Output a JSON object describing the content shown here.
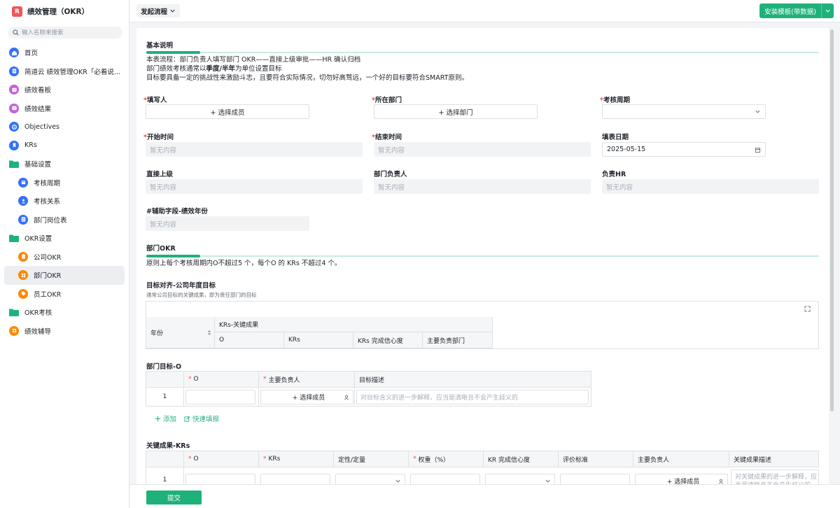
{
  "app": {
    "title": "绩效管理（OKR）",
    "logo": "R"
  },
  "search": {
    "placeholder": "输入名称来搜索"
  },
  "nav": {
    "home": "首页",
    "guide": "简道云 绩效管理OKR「必看说...",
    "board": "绩效看板",
    "result": "绩效结果",
    "objectives": "Objectives",
    "krs": "KRs",
    "basic_settings": "基础设置",
    "period": "考核周期",
    "relation": "考核关系",
    "positions": "部门岗位表",
    "okr_settings": "OKR设置",
    "company_okr": "公司OKR",
    "dept_okr": "部门OKR",
    "staff_okr": "员工OKR",
    "okr_review": "OKR考核",
    "coaching": "绩效辅导"
  },
  "toolbar": {
    "flow": "发起流程",
    "install": "安装模板(带数据)"
  },
  "basic": {
    "title": "基本说明",
    "line1": "本表流程：部门负责人填写部门 OKR——直接上级审批——HR 确认归档",
    "line2_a": "部门绩效考核通常以",
    "line2_b": "季度/半年",
    "line2_c": "为单位设置目标",
    "line3": "目标要具备一定的挑战性来激励斗志，且要符合实际情况，切勿好高骛远，一个好的目标要符合SMART原则。"
  },
  "fields": {
    "filler": "填写人",
    "filler_btn": "+ 选择成员",
    "dept": "所在部门",
    "dept_btn": "+ 选择部门",
    "cycle": "考核周期",
    "start": "开始时间",
    "end": "结束时间",
    "fill_date": "填表日期",
    "fill_date_value": "2025-05-15",
    "superior": "直接上级",
    "dept_head": "部门负责人",
    "hr": "负责HR",
    "aux_year": "#辅助字段-绩效年份",
    "empty": "暂无内容"
  },
  "dept_okr": {
    "title": "部门OKR",
    "rule": "原则上每个考核周期内O不超过5 个，每个O 的 KRs 不超过4 个。"
  },
  "alignment": {
    "label": "目标对齐-公司年度目标",
    "hint": "通常公司目标的关键成果，即为责任部门的目标",
    "col_year": "年份",
    "col_group": "KRs-关键成果",
    "col_o": "O",
    "col_krs": "KRs",
    "col_conf": "KRs 完成信心度",
    "col_dept": "主要负责部门"
  },
  "dept_goal": {
    "label": "部门目标-O",
    "col_o": "O",
    "col_owner": "主要负责人",
    "col_desc": "目标描述",
    "row_num": "1",
    "owner_btn": "+ 选择成员",
    "desc_placeholder": "对目标含义的进一步解释，应当是清晰且不会产生歧义的",
    "add": "添加",
    "quick": "快速填报"
  },
  "key_results": {
    "label": "关键成果-KRs",
    "col_o": "O",
    "col_krs": "KRs",
    "col_type": "定性/定量",
    "col_weight": "权重（%）",
    "col_conf": "KR 完成信心度",
    "col_criteria": "评价标准",
    "col_owner": "主要负责人",
    "col_desc": "关键成果描述",
    "row_num": "1",
    "owner_btn": "+ 选择成员",
    "desc_placeholder": "对关键成果的进一步解释，应当是清晰且不会产生歧义的"
  },
  "footer": {
    "submit": "提交"
  },
  "colors": {
    "accent": "#1fb17a",
    "required": "#f54a45"
  }
}
